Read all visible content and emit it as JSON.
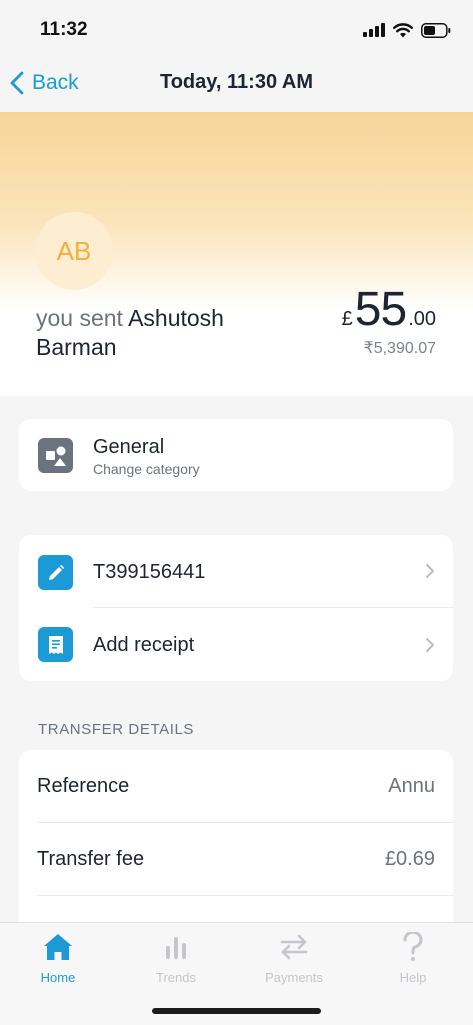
{
  "status_bar": {
    "time": "11:32",
    "icons": [
      "signal-icon",
      "wifi-icon",
      "battery-icon"
    ]
  },
  "nav": {
    "back_label": "Back",
    "title": "Today, 11:30 AM",
    "accent_color": "#1b9ad6"
  },
  "transaction": {
    "avatar_initials": "AB",
    "sent_prefix": "you sent",
    "recipient": "Ashutosh Barman",
    "currency_symbol": "£",
    "amount_whole": "55",
    "amount_decimal": ".00",
    "converted_amount": "₹5,390.07"
  },
  "category": {
    "title": "General",
    "subtitle": "Change category",
    "icon": "shapes-icon"
  },
  "actions": [
    {
      "label": "T399156441",
      "icon": "pencil-icon"
    },
    {
      "label": "Add receipt",
      "icon": "receipt-icon"
    }
  ],
  "transfer_details": {
    "header": "TRANSFER DETAILS",
    "rows": [
      {
        "label": "Reference",
        "value": "Annu"
      },
      {
        "label": "Transfer fee",
        "value": "£0.69"
      }
    ]
  },
  "tabs": [
    {
      "label": "Home",
      "icon": "home-icon",
      "active": true
    },
    {
      "label": "Trends",
      "icon": "bar-chart-icon",
      "active": false
    },
    {
      "label": "Payments",
      "icon": "transfer-arrows-icon",
      "active": false
    },
    {
      "label": "Help",
      "icon": "question-mark-icon",
      "active": false
    }
  ]
}
